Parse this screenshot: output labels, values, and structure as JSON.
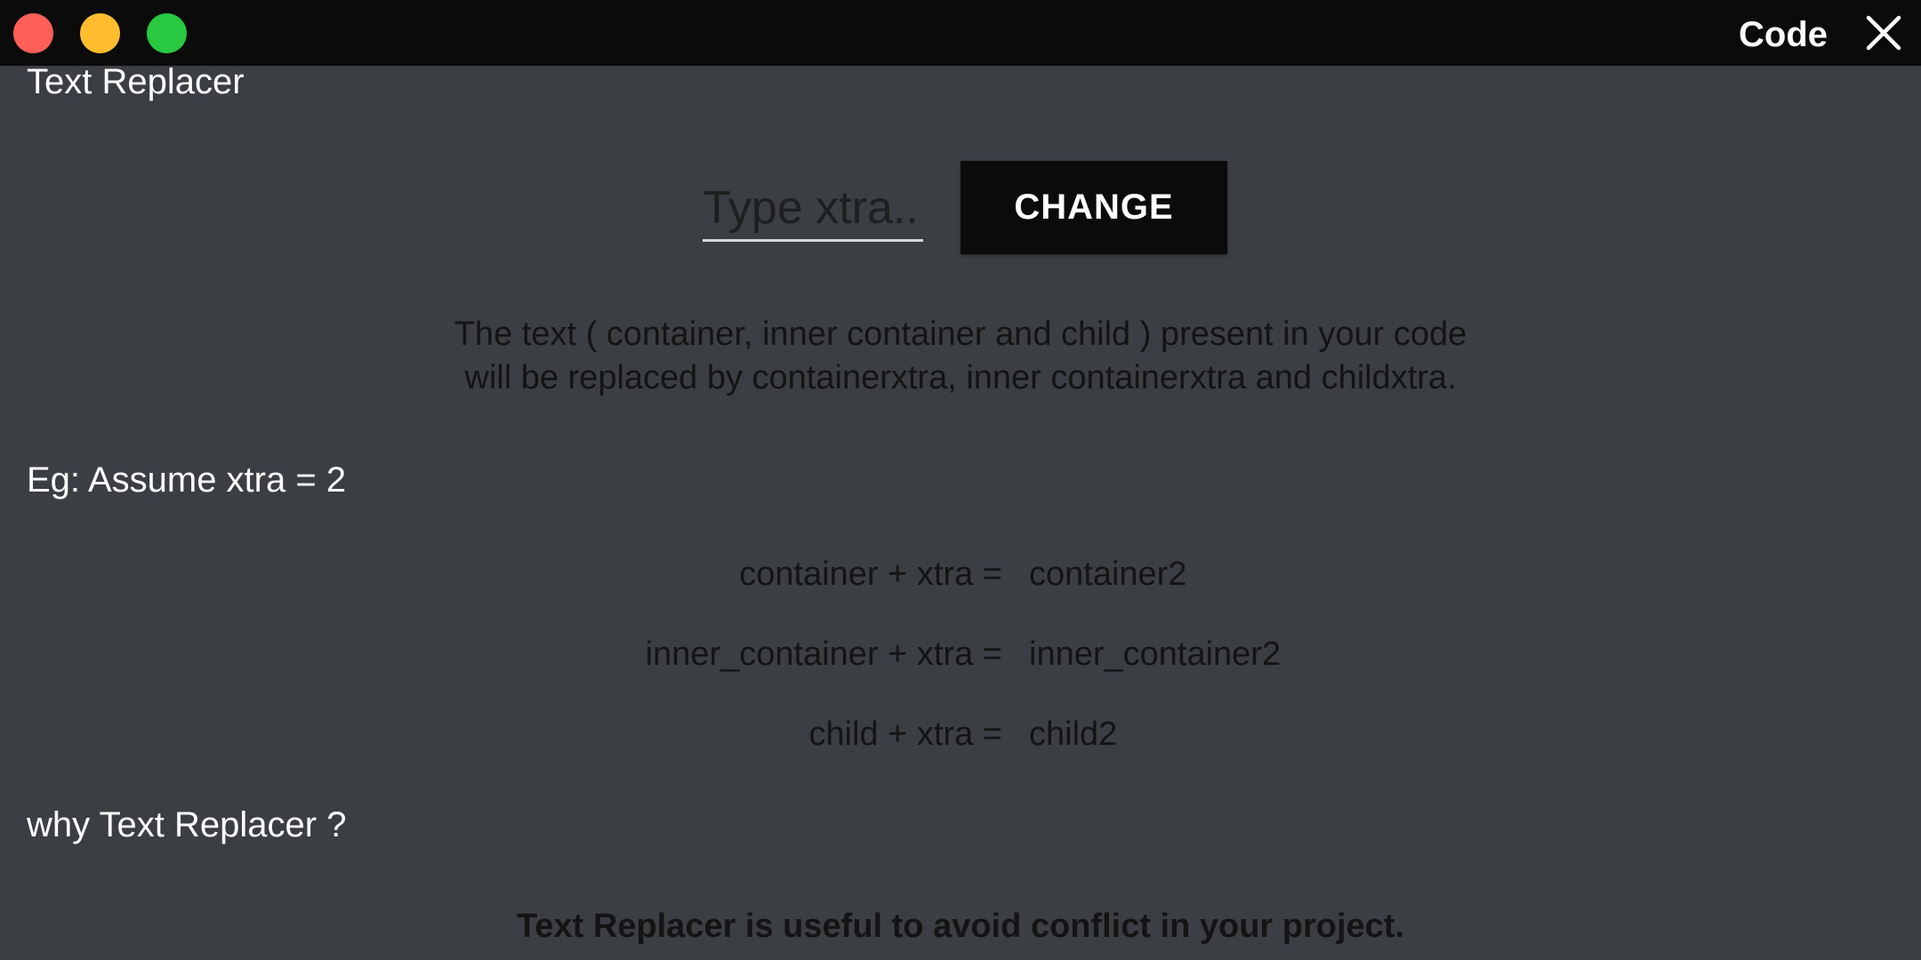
{
  "window": {
    "title": "Code",
    "traffic_lights": [
      {
        "name": "close",
        "color": "#ff5f57"
      },
      {
        "name": "minimize",
        "color": "#febc2e"
      },
      {
        "name": "maximize",
        "color": "#28c840"
      }
    ],
    "close_icon": "close-icon"
  },
  "app": {
    "title": "Text Replacer"
  },
  "form": {
    "input_placeholder": "Type xtra..",
    "input_value": "",
    "button_label": "CHANGE"
  },
  "description": {
    "line1": "The text ( container, inner container and child ) present in your code",
    "line2": "will be replaced by containerxtra, inner containerxtra and childxtra."
  },
  "example": {
    "heading": "Eg: Assume xtra = 2",
    "rows": [
      {
        "lhs": "container + xtra =",
        "rhs": "container2"
      },
      {
        "lhs": "inner_container + xtra =",
        "rhs": "inner_container2"
      },
      {
        "lhs": "child + xtra =",
        "rhs": "child2"
      }
    ]
  },
  "why": {
    "heading": "why Text Replacer ?",
    "text": "Text Replacer is useful to avoid conflict in your project."
  },
  "colors": {
    "background": "#3b3e42",
    "titlebar": "#0b0b0c",
    "button": "#0b0b0c",
    "heading_text": "#ffffff",
    "body_text": "#141414"
  }
}
